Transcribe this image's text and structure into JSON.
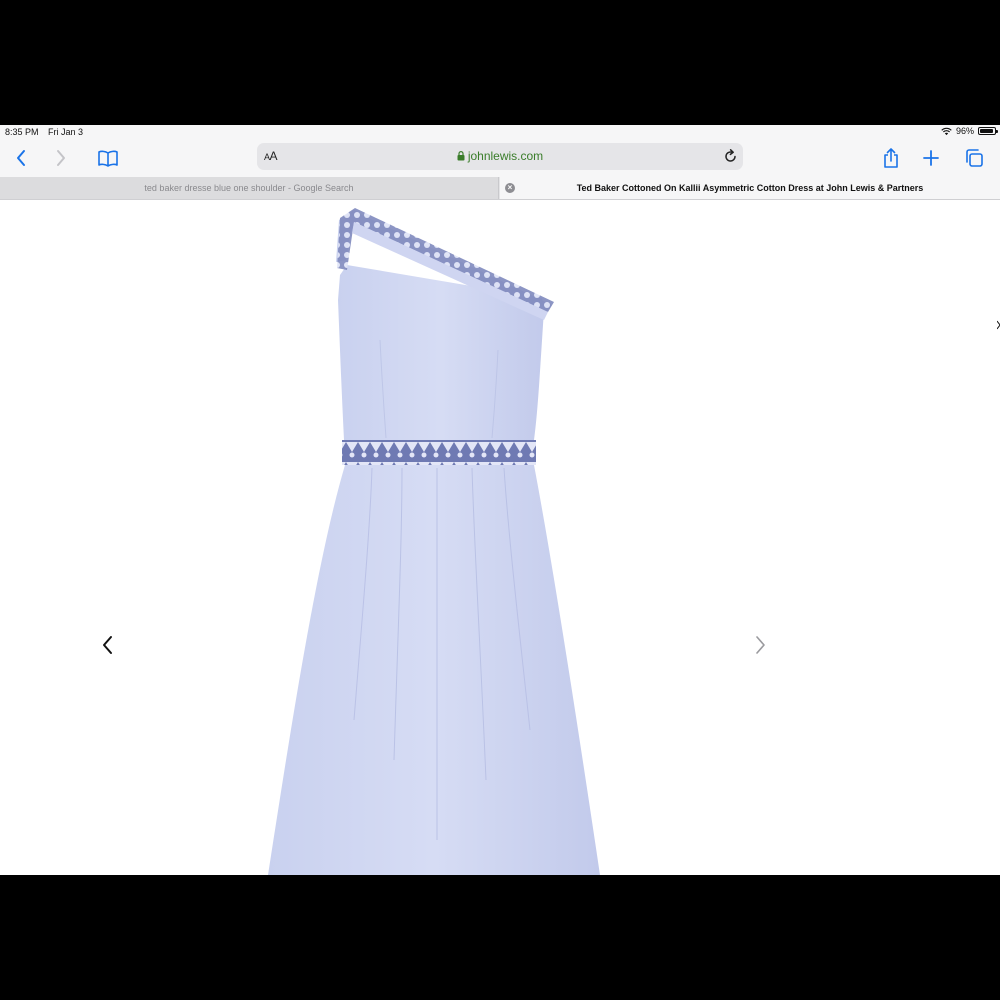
{
  "status_bar": {
    "time": "8:35 PM",
    "date": "Fri Jan 3",
    "battery_percent": "96%",
    "battery_level": 0.96
  },
  "toolbar": {
    "reader_label_small": "A",
    "reader_label_large": "A",
    "url": "johnlewis.com",
    "icons": [
      "back-icon",
      "forward-icon",
      "bookmarks-icon",
      "lock-icon",
      "reload-icon",
      "share-icon",
      "plus-icon",
      "tabs-icon"
    ]
  },
  "tabs": [
    {
      "label": "ted baker dresse blue one shoulder - Google Search",
      "active": false
    },
    {
      "label": "Ted Baker Cottoned On Kallii Asymmetric Cotton Dress at John Lewis & Partners",
      "active": true
    }
  ],
  "product": {
    "image_subject": "light blue one-shoulder cotton dress with lace trim",
    "dress_color": "#c5cdee",
    "trim_color": "#8a93c4"
  },
  "colors": {
    "accent": "#1a73e8",
    "url_green": "#3a7d2a"
  }
}
